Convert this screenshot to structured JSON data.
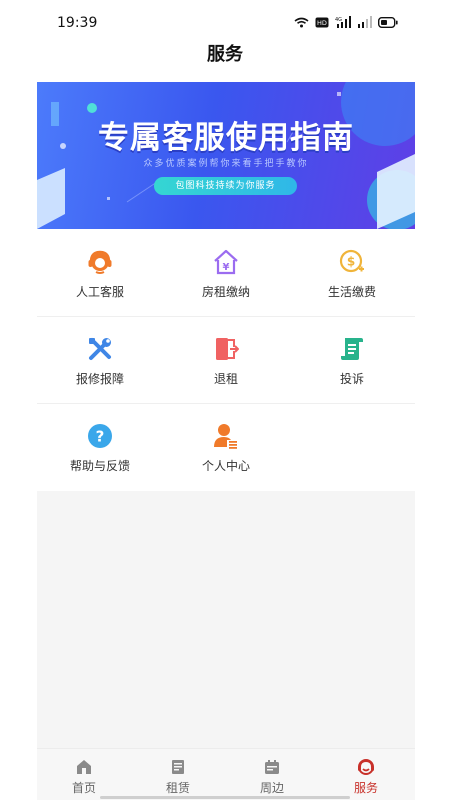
{
  "status": {
    "time": "19:39",
    "icons": [
      "wifi-icon",
      "hd-icon",
      "signal-4g-icon",
      "signal-icon",
      "battery-icon"
    ],
    "hd_label": "HD",
    "net_label": "4G"
  },
  "header": {
    "title": "服务"
  },
  "banner": {
    "title": "专属客服使用指南",
    "subtitle": "众多优质案例帮你来看手把手教你",
    "pill": "包图科技持续为你服务"
  },
  "services": [
    {
      "label": "人工客服",
      "icon": "customer-service-headset-icon",
      "color": "#f07a2a"
    },
    {
      "label": "房租缴纳",
      "icon": "house-yuan-icon",
      "color": "#9b6cf0"
    },
    {
      "label": "生活缴费",
      "icon": "dollar-coin-icon",
      "color": "#f0b43a"
    },
    {
      "label": "报修报障",
      "icon": "repair-tools-icon",
      "color": "#3f86e6"
    },
    {
      "label": "退租",
      "icon": "exit-door-icon",
      "color": "#f06262"
    },
    {
      "label": "投诉",
      "icon": "document-scroll-icon",
      "color": "#28b38c"
    },
    {
      "label": "帮助与反馈",
      "icon": "help-question-icon",
      "color": "#3aa7ea"
    },
    {
      "label": "个人中心",
      "icon": "user-profile-icon",
      "color": "#f07a2a"
    }
  ],
  "tabs": [
    {
      "label": "首页",
      "icon": "home-icon",
      "active": false
    },
    {
      "label": "租赁",
      "icon": "lease-icon",
      "active": false
    },
    {
      "label": "周边",
      "icon": "calendar-nearby-icon",
      "active": false
    },
    {
      "label": "服务",
      "icon": "service-icon",
      "active": true
    }
  ],
  "colors": {
    "accent": "#c8312a",
    "banner_start": "#4c7bfb",
    "banner_end": "#5f3fe6"
  }
}
